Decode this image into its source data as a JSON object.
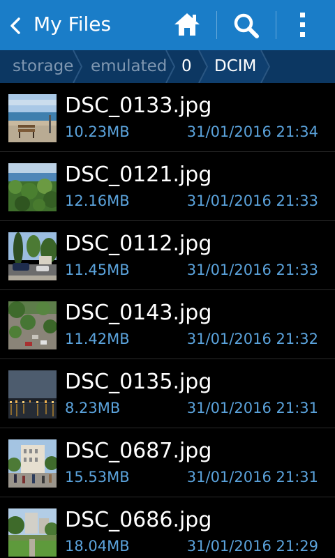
{
  "app": {
    "title": "My Files"
  },
  "action_bar": {
    "color": "#1a7dc8",
    "actions": [
      {
        "name": "home",
        "icon": "home-icon"
      },
      {
        "name": "search",
        "icon": "search-icon"
      },
      {
        "name": "more-options",
        "icon": "more-vertical-icon"
      }
    ]
  },
  "breadcrumb": {
    "color": "#0c3762",
    "items": [
      "storage",
      "emulated",
      "0",
      "DCIM"
    ]
  },
  "files": [
    {
      "name": "DSC_0133.jpg",
      "size": "10.23MB",
      "date": "31/01/2016 21:34"
    },
    {
      "name": "DSC_0121.jpg",
      "size": "12.16MB",
      "date": "31/01/2016 21:33"
    },
    {
      "name": "DSC_0112.jpg",
      "size": "11.45MB",
      "date": "31/01/2016 21:33"
    },
    {
      "name": "DSC_0143.jpg",
      "size": "11.42MB",
      "date": "31/01/2016 21:32"
    },
    {
      "name": "DSC_0135.jpg",
      "size": "8.23MB",
      "date": "31/01/2016 21:31"
    },
    {
      "name": "DSC_0687.jpg",
      "size": "15.53MB",
      "date": "31/01/2016 21:31"
    },
    {
      "name": "DSC_0686.jpg",
      "size": "18.04MB",
      "date": "31/01/2016 21:29"
    }
  ],
  "colors": {
    "background": "#000000",
    "file_name": "#ffffff",
    "file_meta": "#5ba3dc"
  }
}
